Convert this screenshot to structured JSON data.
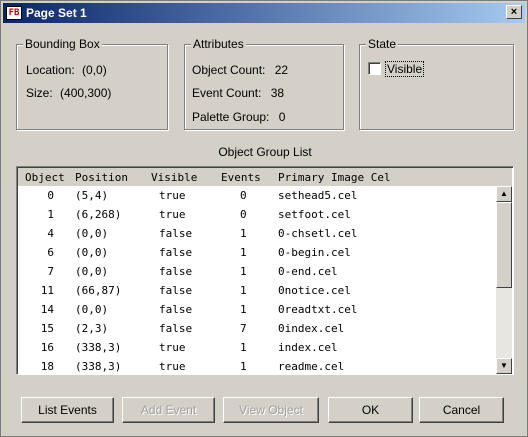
{
  "window": {
    "title": "Page Set 1",
    "icon": "fb-app-icon",
    "close_label": "×"
  },
  "bounding_box": {
    "legend": "Bounding Box",
    "location_label": "Location:",
    "location_value": "(0,0)",
    "size_label": "Size:",
    "size_value": "(400,300)"
  },
  "attributes": {
    "legend": "Attributes",
    "object_count_label": "Object Count:",
    "object_count_value": "22",
    "event_count_label": "Event Count:",
    "event_count_value": "38",
    "palette_group_label": "Palette Group:",
    "palette_group_value": "0"
  },
  "state": {
    "legend": "State",
    "visible_label": "Visible",
    "visible_checked": false
  },
  "object_group_list": {
    "title": "Object Group List",
    "columns": [
      "Object",
      "Position",
      "Visible",
      "Events",
      "Primary Image Cel"
    ],
    "rows": [
      [
        "0",
        "(5,4)",
        "true",
        "0",
        "sethead5.cel"
      ],
      [
        "1",
        "(6,268)",
        "true",
        "0",
        "setfoot.cel"
      ],
      [
        "4",
        "(0,0)",
        "false",
        "1",
        "0-chsetl.cel"
      ],
      [
        "6",
        "(0,0)",
        "false",
        "1",
        "0-begin.cel"
      ],
      [
        "7",
        "(0,0)",
        "false",
        "1",
        "0-end.cel"
      ],
      [
        "11",
        "(66,87)",
        "false",
        "1",
        "0notice.cel"
      ],
      [
        "14",
        "(0,0)",
        "false",
        "1",
        "0readtxt.cel"
      ],
      [
        "15",
        "(2,3)",
        "false",
        "7",
        "0index.cel"
      ],
      [
        "16",
        "(338,3)",
        "true",
        "1",
        "index.cel"
      ],
      [
        "18",
        "(338,3)",
        "true",
        "1",
        "readme.cel"
      ]
    ]
  },
  "buttons": {
    "list_events": "List Events",
    "add_event": "Add Event",
    "view_object": "View Object",
    "ok": "OK",
    "cancel": "Cancel"
  }
}
